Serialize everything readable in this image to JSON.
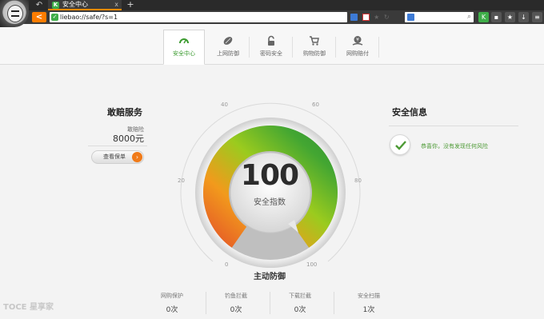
{
  "browser": {
    "tab_title": "安全中心",
    "tab_favicon": "K",
    "new_tab_symbol": "+",
    "close_symbol": "x",
    "back_symbol": "<",
    "url": "liebao://safe/?s=1"
  },
  "tabs": [
    {
      "label": "安全中心",
      "icon": "gauge-icon",
      "active": true
    },
    {
      "label": "上网防御",
      "icon": "rugby-shield-icon",
      "active": false
    },
    {
      "label": "密码安全",
      "icon": "lock-icon",
      "active": false
    },
    {
      "label": "购物防御",
      "icon": "cart-icon",
      "active": false
    },
    {
      "label": "网购赔付",
      "icon": "money-icon",
      "active": false
    }
  ],
  "compensation": {
    "title": "敢赔服务",
    "subtitle": "敢赔险",
    "amount": "8000元",
    "button_label": "查看保单",
    "button_arrow": "›"
  },
  "security_info": {
    "title": "安全信息",
    "message": "恭喜你，没有发现任何风险"
  },
  "gauge": {
    "score": "100",
    "label": "安全指数",
    "ticks": [
      "0",
      "20",
      "40",
      "60",
      "80",
      "100"
    ],
    "caption": "主动防御",
    "value": 100
  },
  "stats": [
    {
      "label": "网购保护",
      "value": "0次"
    },
    {
      "label": "钓鱼拦截",
      "value": "0次"
    },
    {
      "label": "下载拦截",
      "value": "0次"
    },
    {
      "label": "安全扫描",
      "value": "1次"
    }
  ],
  "colors": {
    "accent_green": "#3a9a2e",
    "accent_orange": "#f07a18",
    "risk_red": "#e24a2a"
  },
  "watermark": "TOCE 星享家"
}
